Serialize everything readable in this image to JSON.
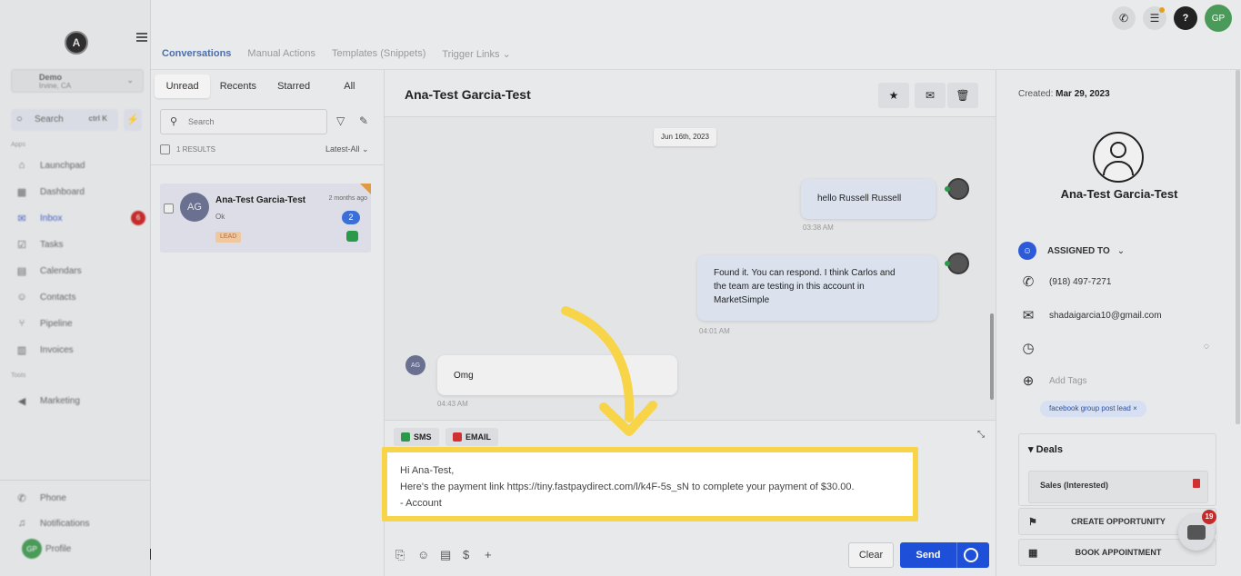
{
  "sidebar": {
    "logo_letter": "A",
    "account": {
      "name": "Demo",
      "location": "Irvine, CA"
    },
    "search": {
      "label": "Search",
      "shortcut": "ctrl K"
    },
    "section_apps": "Apps",
    "section_tools": "Tools",
    "items": [
      {
        "label": "Launchpad",
        "icon": "rocket-icon"
      },
      {
        "label": "Dashboard",
        "icon": "dashboard-icon"
      },
      {
        "label": "Inbox",
        "icon": "inbox-icon",
        "badge": "6"
      },
      {
        "label": "Tasks",
        "icon": "tasks-icon"
      },
      {
        "label": "Calendars",
        "icon": "calendar-icon"
      },
      {
        "label": "Contacts",
        "icon": "contacts-icon"
      },
      {
        "label": "Pipeline",
        "icon": "pipeline-icon"
      },
      {
        "label": "Invoices",
        "icon": "invoice-icon"
      },
      {
        "label": "Marketing",
        "icon": "megaphone-icon"
      }
    ],
    "bottom": [
      {
        "label": "Phone"
      },
      {
        "label": "Notifications"
      },
      {
        "label": "Profile",
        "avatar": "GP"
      }
    ]
  },
  "topbar": {
    "avatar": "GP",
    "help": "?"
  },
  "tabs": [
    "Conversations",
    "Manual Actions",
    "Templates (Snippets)",
    "Trigger Links"
  ],
  "list": {
    "filters": [
      "Unread",
      "Recents",
      "Starred",
      "All"
    ],
    "search_placeholder": "Search",
    "results": "1 RESULTS",
    "sort": "Latest-All",
    "conversation": {
      "initials": "AG",
      "name": "Ana-Test Garcia-Test",
      "time": "2 months ago",
      "preview": "Ok",
      "count": "2",
      "tag": "LEAD"
    }
  },
  "chat": {
    "title": "Ana-Test Garcia-Test",
    "date": "Jun 16th, 2023",
    "messages": [
      {
        "text": "hello Russell Russell",
        "time": "03:38 AM"
      },
      {
        "text_lines": [
          "Found it. You can respond. I think Carlos and",
          "the team are testing in this account in",
          "MarketSimple"
        ],
        "time": "04:01 AM"
      },
      {
        "text": "Omg",
        "time": "04:43 AM",
        "initials": "AG"
      }
    ]
  },
  "composer": {
    "channels": [
      "SMS",
      "EMAIL"
    ],
    "lines": [
      "Hi Ana-Test,",
      "Here's the payment link https://tiny.fastpaydirect.com/l/k4F-5s_sN to complete your payment of $30.00.",
      "- Account"
    ],
    "clear_label": "Clear",
    "send_label": "Send"
  },
  "contact": {
    "created_label": "Created:",
    "created_date": "Mar 29, 2023",
    "name": "Ana-Test Garcia-Test",
    "assigned_label": "ASSIGNED TO",
    "phone": "(918) 497-7271",
    "email": "shadaigarcia10@gmail.com",
    "add_tags": "Add Tags",
    "tag": "facebook group post lead",
    "deals_label": "Deals",
    "deal": "Sales (Interested)",
    "create_opportunity": "CREATE OPPORTUNITY",
    "book_appointment": "BOOK APPOINTMENT",
    "widget_badge": "19"
  },
  "colors": {
    "accent": "#1e4fd8",
    "highlight": "#f7d448",
    "arrow": "#f7d448"
  }
}
